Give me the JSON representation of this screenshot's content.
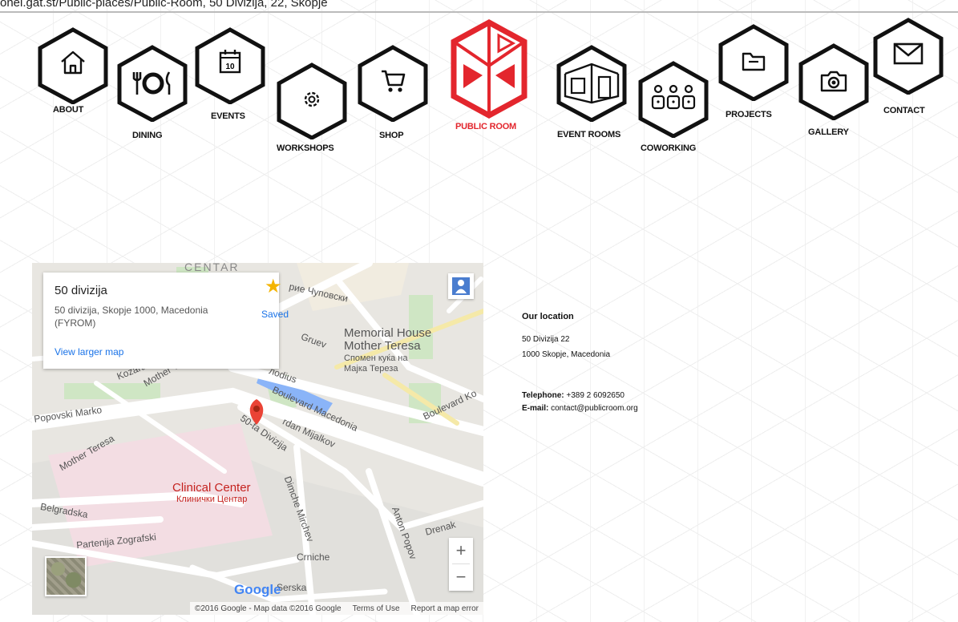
{
  "browser": {
    "top_text": "onel.gat.st/Public-places/Public-Room, 50 Divizija, 22, Skopje"
  },
  "nav": [
    {
      "label": "ABOUT",
      "icon": "home-icon"
    },
    {
      "label": "DINING",
      "icon": "dining-icon"
    },
    {
      "label": "EVENTS",
      "icon": "calendar-icon",
      "icon_text": "10"
    },
    {
      "label": "WORKSHOPS",
      "icon": "gear-icon"
    },
    {
      "label": "SHOP",
      "icon": "cart-icon"
    },
    {
      "label": "PUBLIC ROOM",
      "icon": "public-room-logo"
    },
    {
      "label": "EVENT ROOMS",
      "icon": "room-icon"
    },
    {
      "label": "COWORKING",
      "icon": "coworking-icon"
    },
    {
      "label": "PROJECTS",
      "icon": "folder-icon"
    },
    {
      "label": "GALLERY",
      "icon": "camera-icon"
    },
    {
      "label": "CONTACT",
      "icon": "envelope-icon"
    }
  ],
  "colors": {
    "brand_red": "#e3262d",
    "hex_stroke": "#111111",
    "map_link": "#1a73e8",
    "star": "#f4b400"
  },
  "map": {
    "card": {
      "title": "50 divizija",
      "address_line1": "50 divizija, Skopje 1000, Macedonia",
      "address_line2": "(FYROM)",
      "saved_label": "Saved",
      "larger_map_link": "View larger map"
    },
    "labels": {
      "centar": "CENTAR",
      "chupovski": "рие Чуповски",
      "memorial_1": "Memorial House",
      "memorial_2": "Mother Teresa",
      "memorial_3": "Спомен куќа на",
      "memorial_4": "Мајка Тереза",
      "gruev": "Gruev",
      "modius": "лodius",
      "kozara": "Kozara",
      "mother_teresa_1": "Mother Teresa",
      "mother_teresa_2": "Mother Teresa",
      "popovski": "Popovski Marko",
      "blvd_macedonia": "Boulevard Macedonia",
      "blvd_ko": "Boulevard Ko",
      "blvd_kolek": "Boulevard Ko",
      "mijalkov": "rdan Mijalkov",
      "divizija": "50-ta Divizija",
      "clinical_1": "Clinical Center",
      "clinical_2": "Клинички Центар",
      "belgradska": "Belgradska",
      "dimche": "Dimche Mirchev",
      "partenija": "Partenija Zografski",
      "anton": "Anton Popov",
      "drenak": "Drenak",
      "crniche": "Crniche",
      "serska": "Serska",
      "google": "Google"
    },
    "zoom_in": "+",
    "zoom_out": "−",
    "attribution": "©2016 Google - Map data ©2016 Google",
    "terms": "Terms of Use",
    "report": "Report a map error"
  },
  "location": {
    "title": "Our location",
    "address1": "50 Divizija 22",
    "address2": "1000 Skopje, Macedonia",
    "phone_label": "Telephone:",
    "phone_value": "+389 2 6092650",
    "email_label": "E-mail:",
    "email_value": "contact@publicroom.org"
  }
}
